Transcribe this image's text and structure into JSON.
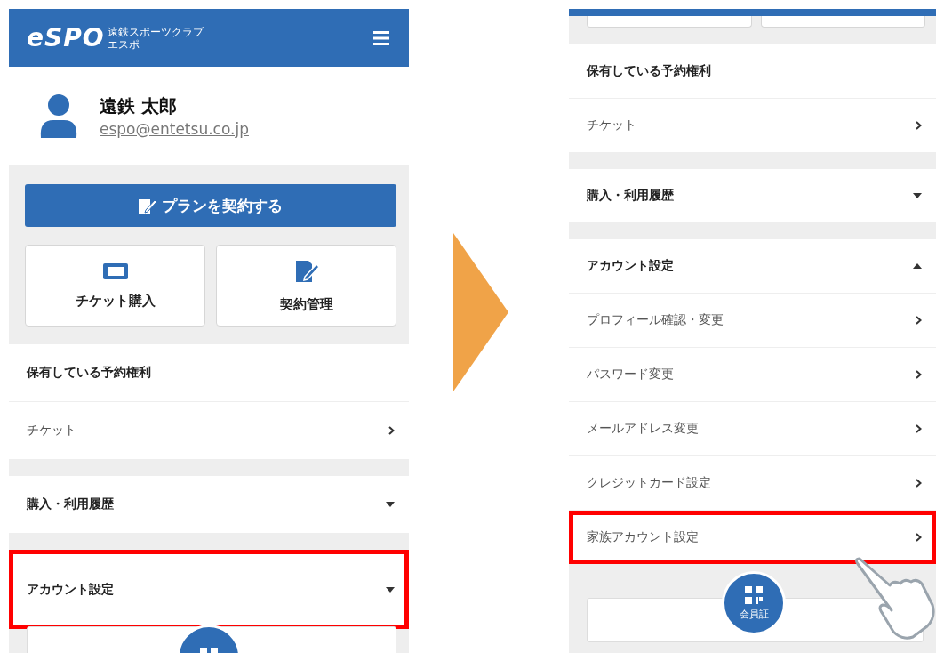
{
  "screens": [
    {
      "kind": "top",
      "header": {
        "logo": "eSPO",
        "logo_subtitle": "遠鉄スポーツクラブ",
        "logo_subtitle_2": "エスポ"
      },
      "profile": {
        "name": "遠鉄 太郎",
        "email": "espo@entetsu.co.jp"
      },
      "plan_button": "プランを契約する",
      "action_cards": [
        {
          "kind": "ticket",
          "label": "チケット購入"
        },
        {
          "kind": "contract",
          "label": "契約管理"
        }
      ],
      "sections": [
        {
          "kind": "heading",
          "title": "保有している予約権利",
          "items": [
            {
              "label": "チケット",
              "highlighted": false
            }
          ]
        },
        {
          "kind": "accordion",
          "title": "購入・利用履歴",
          "expanded": false,
          "highlighted": false
        },
        {
          "kind": "accordion",
          "title": "アカウント設定",
          "expanded": false,
          "highlighted": true
        }
      ]
    },
    {
      "kind": "scrolled",
      "member_card_label": "会員証",
      "sections": [
        {
          "kind": "heading",
          "title": "保有している予約権利",
          "items": [
            {
              "label": "チケット",
              "highlighted": false
            }
          ]
        },
        {
          "kind": "accordion",
          "title": "購入・利用履歴",
          "expanded": false,
          "highlighted": false
        },
        {
          "kind": "accordion",
          "title": "アカウント設定",
          "expanded": true,
          "highlighted": false,
          "items": [
            {
              "label": "プロフィール確認・変更",
              "highlighted": false
            },
            {
              "label": "パスワード変更",
              "highlighted": false
            },
            {
              "label": "メールアドレス変更",
              "highlighted": false
            },
            {
              "label": "クレジットカード設定",
              "highlighted": false
            },
            {
              "label": "家族アカウント設定",
              "highlighted": true
            }
          ]
        }
      ]
    }
  ]
}
